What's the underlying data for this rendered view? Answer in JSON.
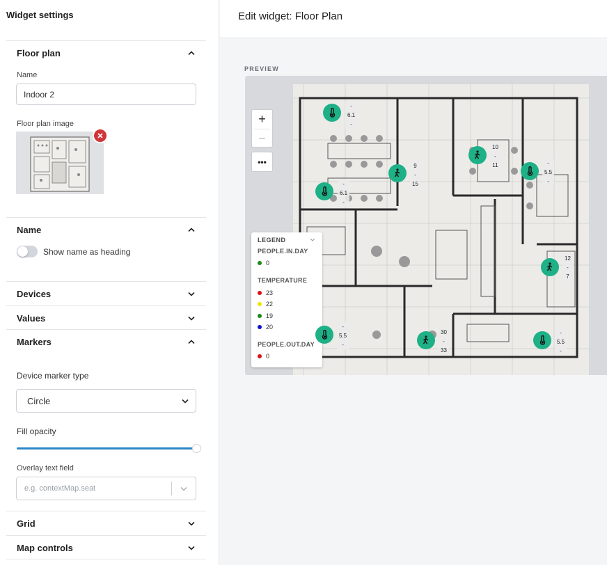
{
  "sidebar": {
    "title": "Widget settings",
    "floor_plan": {
      "label": "Floor plan",
      "name_label": "Name",
      "name_value": "Indoor 2",
      "image_label": "Floor plan image"
    },
    "name_section": {
      "label": "Name",
      "toggle_label": "Show name as heading"
    },
    "devices_label": "Devices",
    "values_label": "Values",
    "markers": {
      "label": "Markers",
      "marker_type_label": "Device marker type",
      "marker_type_value": "Circle",
      "fill_opacity_label": "Fill opacity",
      "fill_opacity_value": 1,
      "overlay_label": "Overlay text field",
      "overlay_placeholder": "e.g. contextMap.seat"
    },
    "grid_label": "Grid",
    "map_controls_label": "Map controls"
  },
  "header": {
    "title": "Edit widget: Floor Plan"
  },
  "preview": {
    "label": "PREVIEW",
    "zoom_in": "+",
    "zoom_out": "−",
    "more": "•••",
    "legend": {
      "title": "LEGEND",
      "sections": [
        {
          "name": "PEOPLE.IN.DAY",
          "items": [
            {
              "color": "#1a8a1a",
              "value": "0"
            }
          ]
        },
        {
          "name": "TEMPERATURE",
          "items": [
            {
              "color": "#e01010",
              "value": "23"
            },
            {
              "color": "#f2e200",
              "value": "22"
            },
            {
              "color": "#1a8a1a",
              "value": "19"
            },
            {
              "color": "#1010d0",
              "value": "20"
            }
          ]
        },
        {
          "name": "PEOPLE.OUT.DAY",
          "items": [
            {
              "color": "#e01010",
              "value": "0"
            }
          ]
        }
      ]
    },
    "markers": [
      {
        "icon": "thermometer",
        "lines": [
          "-",
          "6.1",
          "-"
        ]
      },
      {
        "icon": "thermometer",
        "lines": [
          "-",
          "6.1",
          "-"
        ]
      },
      {
        "icon": "walking-person",
        "lines": [
          "9",
          "-",
          "15"
        ]
      },
      {
        "icon": "walking-person",
        "lines": [
          "10",
          "-",
          "11"
        ]
      },
      {
        "icon": "thermometer",
        "lines": [
          "-",
          "5.5",
          "-"
        ]
      },
      {
        "icon": "walking-person",
        "lines": [
          "12",
          "-",
          "7"
        ]
      },
      {
        "icon": "thermometer",
        "lines": [
          "-",
          "5.5",
          "-"
        ]
      },
      {
        "icon": "walking-person",
        "lines": [
          "30",
          "-",
          "33"
        ]
      },
      {
        "icon": "thermometer",
        "lines": [
          "-",
          "5.5",
          "-"
        ]
      }
    ]
  }
}
